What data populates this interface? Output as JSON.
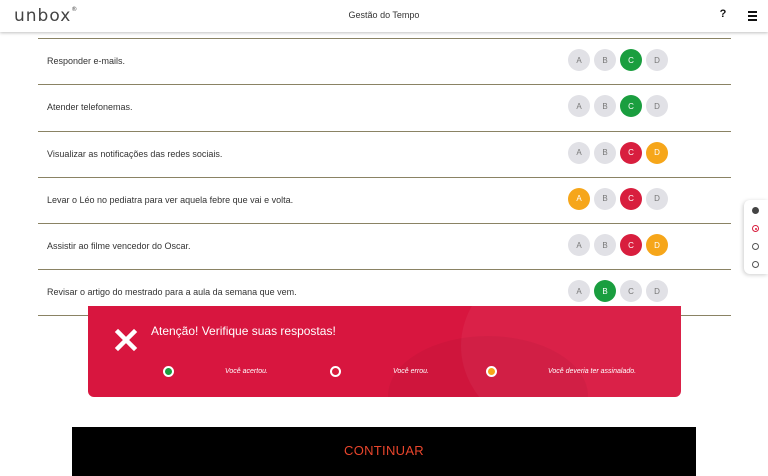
{
  "header": {
    "logo": "unbox",
    "logo_mark": "®",
    "title": "Gestão do Tempo",
    "help_label": "?",
    "menu_icon": "hamburger-icon"
  },
  "questions": [
    {
      "text": "Responder e-mails.",
      "options": [
        {
          "label": "A",
          "state": "neutral"
        },
        {
          "label": "B",
          "state": "neutral"
        },
        {
          "label": "C",
          "state": "correct"
        },
        {
          "label": "D",
          "state": "neutral"
        }
      ]
    },
    {
      "text": "Atender telefonemas.",
      "options": [
        {
          "label": "A",
          "state": "neutral"
        },
        {
          "label": "B",
          "state": "neutral"
        },
        {
          "label": "C",
          "state": "correct"
        },
        {
          "label": "D",
          "state": "neutral"
        }
      ]
    },
    {
      "text": "Visualizar as notificações das redes sociais.",
      "options": [
        {
          "label": "A",
          "state": "neutral"
        },
        {
          "label": "B",
          "state": "neutral"
        },
        {
          "label": "C",
          "state": "wrong"
        },
        {
          "label": "D",
          "state": "missed"
        }
      ]
    },
    {
      "text": "Levar o Léo no pediatra para ver aquela febre que vai e volta.",
      "options": [
        {
          "label": "A",
          "state": "missed"
        },
        {
          "label": "B",
          "state": "neutral"
        },
        {
          "label": "C",
          "state": "wrong"
        },
        {
          "label": "D",
          "state": "neutral"
        }
      ]
    },
    {
      "text": "Assistir ao filme vencedor do Oscar.",
      "options": [
        {
          "label": "A",
          "state": "neutral"
        },
        {
          "label": "B",
          "state": "neutral"
        },
        {
          "label": "C",
          "state": "wrong"
        },
        {
          "label": "D",
          "state": "missed"
        }
      ]
    },
    {
      "text": "Revisar o artigo do mestrado para a aula da semana que vem.",
      "options": [
        {
          "label": "A",
          "state": "neutral"
        },
        {
          "label": "B",
          "state": "correct"
        },
        {
          "label": "C",
          "state": "neutral"
        },
        {
          "label": "D",
          "state": "neutral"
        }
      ]
    }
  ],
  "pager": [
    "filled",
    "active",
    "empty",
    "empty"
  ],
  "alert": {
    "icon": "close-x-icon",
    "title": "Atenção! Verifique suas respostas!",
    "legend": [
      {
        "label": "Você acertou.",
        "color": "#1a9e3f"
      },
      {
        "label": "Você errou.",
        "color": "#d81e3e"
      },
      {
        "label": "Você deveria ter assinalado.",
        "color": "#f6a61a"
      }
    ]
  },
  "colors": {
    "correct": "#1a9e3f",
    "wrong": "#d81e3e",
    "missed": "#f6a61a",
    "alert_bg": "#d8163f",
    "continue_text": "#e8452c"
  },
  "continue_label": "CONTINUAR"
}
